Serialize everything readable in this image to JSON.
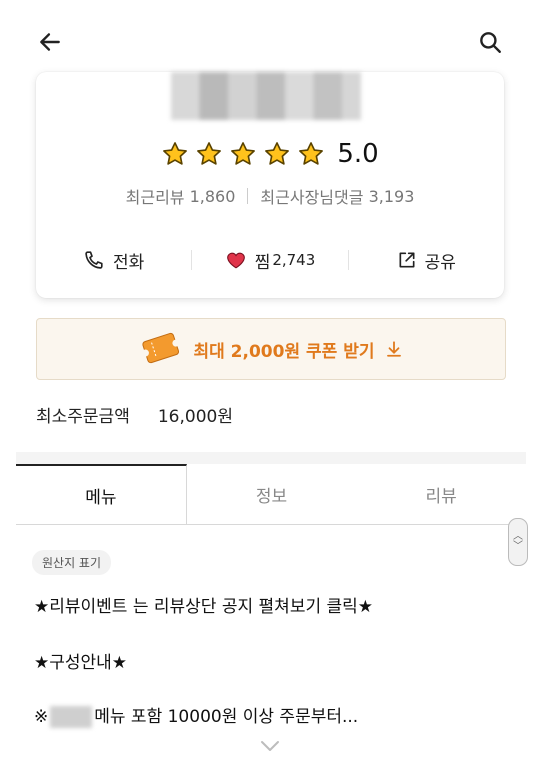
{
  "header": {
    "back_icon": "arrow-left-icon",
    "search_icon": "search-icon"
  },
  "store": {
    "rating": "5.0",
    "stars": 5,
    "recent_reviews_label": "최근리뷰",
    "recent_reviews_count": "1,860",
    "owner_replies_label": "최근사장님댓글",
    "owner_replies_count": "3,193"
  },
  "actions": {
    "call_label": "전화",
    "like_label": "찜",
    "like_count": "2,743",
    "share_label": "공유",
    "heart_color": "#e0344a"
  },
  "coupon": {
    "label": "최대 2,000원 쿠폰 받기",
    "color": "#e07a1d"
  },
  "min_order": {
    "label": "최소주문금액",
    "value": "16,000원"
  },
  "tabs": [
    {
      "label": "메뉴",
      "active": true
    },
    {
      "label": "정보",
      "active": false
    },
    {
      "label": "리뷰",
      "active": false
    }
  ],
  "menu_notice": {
    "origin_badge": "원산지 표기",
    "line1": "★리뷰이벤트 는 리뷰상단 공지 펼쳐보기 클릭★",
    "line2": "★구성안내★",
    "line3_prefix": "※",
    "line3_suffix": "메뉴 포함 10000원 이상 주문부터..."
  }
}
